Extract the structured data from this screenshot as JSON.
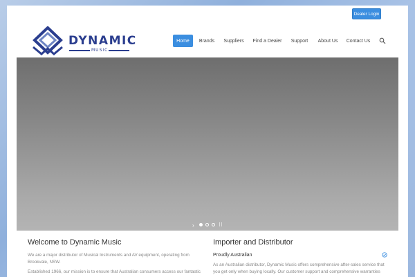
{
  "header": {
    "dealer_login": "Dealer Login",
    "logo_word": "DYNAMIC",
    "logo_sub": "MUSIC"
  },
  "nav": {
    "items": [
      "Home",
      "Brands",
      "Suppliers",
      "Find a Dealer",
      "Support",
      "About Us",
      "Contact Us"
    ],
    "active": "Home",
    "search_icon": "search-icon"
  },
  "slider": {
    "arrow": "›",
    "dots": 3,
    "active_dot": 1
  },
  "welcome": {
    "title": "Welcome to Dynamic Music",
    "p1_line1": "We are a major distributor of Musical Instruments and AV equipment, operating from",
    "p1_line2": "Brookvale, NSW.",
    "p2_line1": "Established 1966, our mission is to ensure that Australian consumers access our fantastic"
  },
  "importer": {
    "title": "Importer and Distributor",
    "subtitle": "Proudly Australian",
    "p1_line1": "As an Australian distributor, Dynamic Music offers comprehensive after-sales service that",
    "p1_line2": "you get only when buying locally. Our customer support and comprehensive warranties"
  },
  "colors": {
    "accent": "#3b8ee0",
    "logo": "#2b3e8f"
  }
}
